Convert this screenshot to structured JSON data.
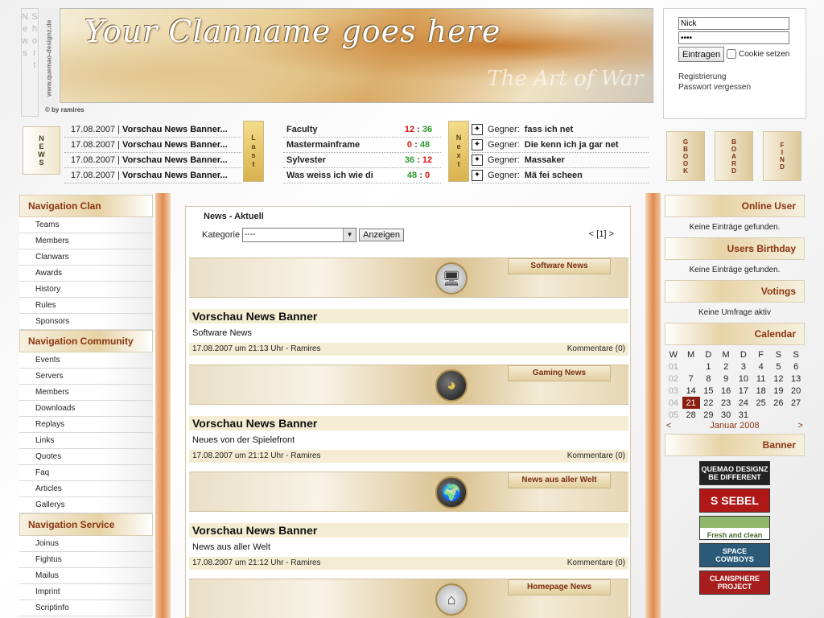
{
  "header": {
    "shortnews_label": "Short News",
    "domain": "www.quemao-designz.de",
    "byline": "© by ramires",
    "title": "Your Clanname goes here",
    "subtitle": "The Art of War"
  },
  "login": {
    "username": "Nick",
    "password": "****",
    "submit_label": "Eintragen",
    "cookie_label": "Cookie setzen",
    "register_link": "Registrierung",
    "forgot_link": "Passwort vergessen"
  },
  "ticker": {
    "news_tab": "NEWS",
    "shortnews": [
      {
        "date": "17.08.2007",
        "title": "Vorschau News Banner..."
      },
      {
        "date": "17.08.2007",
        "title": "Vorschau News Banner..."
      },
      {
        "date": "17.08.2007",
        "title": "Vorschau News Banner..."
      },
      {
        "date": "17.08.2007",
        "title": "Vorschau News Banner..."
      }
    ],
    "last_tab": "Last",
    "last_matches": [
      {
        "name": "Faculty",
        "score_a": "12",
        "score_b": "36",
        "a_color": "red",
        "b_color": "green"
      },
      {
        "name": "Mastermainframe",
        "score_a": "0",
        "score_b": "48",
        "a_color": "red",
        "b_color": "green"
      },
      {
        "name": "Sylvester",
        "score_a": "36",
        "score_b": "12",
        "a_color": "green",
        "b_color": "red"
      },
      {
        "name": "Was weiss ich wie di",
        "score_a": "48",
        "score_b": "0",
        "a_color": "green",
        "b_color": "red"
      }
    ],
    "next_tab": "Next",
    "next_matches": [
      {
        "label": "Gegner:",
        "name": "fass ich net"
      },
      {
        "label": "Gegner:",
        "name": "Die kenn ich ja gar net"
      },
      {
        "label": "Gegner:",
        "name": "Massaker"
      },
      {
        "label": "Gegner:",
        "name": "Mä fei scheen"
      }
    ],
    "quick_links": [
      "GBOOK",
      "BOARD",
      "FIND"
    ]
  },
  "left_nav": {
    "sections": [
      {
        "title": "Navigation Clan",
        "items": [
          "Teams",
          "Members",
          "Clanwars",
          "Awards",
          "History",
          "Rules",
          "Sponsors"
        ]
      },
      {
        "title": "Navigation Community",
        "items": [
          "Events",
          "Servers",
          "Members",
          "Downloads",
          "Replays",
          "Links",
          "Quotes",
          "Faq",
          "Articles",
          "Gallerys"
        ]
      },
      {
        "title": "Navigation Service",
        "items": [
          "Joinus",
          "Fightus",
          "Mailus",
          "Imprint",
          "Scriptinfo"
        ]
      }
    ]
  },
  "main": {
    "title": "News - Aktuell",
    "filter_label": "Kategorie",
    "filter_value": "----",
    "filter_button": "Anzeigen",
    "pager": "< [1] >",
    "articles": [
      {
        "category": "Software News",
        "headline": "Vorschau News Banner",
        "text": "Software News",
        "meta": "17.08.2007 um 21:13 Uhr - Ramires",
        "comments": "Kommentare (0)",
        "icon": "computer-icon"
      },
      {
        "category": "Gaming News",
        "headline": "Vorschau News Banner",
        "text": "Neues von der Spielefront",
        "meta": "17.08.2007 um 21:12 Uhr - Ramires",
        "comments": "Kommentare (0)",
        "icon": "pacman-icon"
      },
      {
        "category": "News aus aller Welt",
        "headline": "Vorschau News Banner",
        "text": "News aus aller Welt",
        "meta": "17.08.2007 um 21:12 Uhr - Ramires",
        "comments": "Kommentare (0)",
        "icon": "globe-icon"
      },
      {
        "category": "Homepage News",
        "icon": "house-icon"
      }
    ]
  },
  "right": {
    "online_title": "Online User",
    "online_text": "Keine Einträge gefunden.",
    "birthday_title": "Users Birthday",
    "birthday_text": "Keine Einträge gefunden.",
    "votings_title": "Votings",
    "votings_text": "Keine Umfrage aktiv",
    "calendar_title": "Calendar",
    "calendar": {
      "weekdays": [
        "W",
        "M",
        "D",
        "M",
        "D",
        "F",
        "S",
        "S"
      ],
      "weeks": [
        [
          "01",
          "",
          "1",
          "2",
          "3",
          "4",
          "5",
          "6"
        ],
        [
          "02",
          "7",
          "8",
          "9",
          "10",
          "11",
          "12",
          "13"
        ],
        [
          "03",
          "14",
          "15",
          "16",
          "17",
          "18",
          "19",
          "20"
        ],
        [
          "04",
          "21",
          "22",
          "23",
          "24",
          "25",
          "26",
          "27"
        ],
        [
          "05",
          "28",
          "29",
          "30",
          "31",
          "",
          "",
          ""
        ]
      ],
      "today": "21",
      "prev": "<",
      "month": "Januar 2008",
      "next": ">"
    },
    "banner_title": "Banner",
    "banners": [
      {
        "line1": "QUEMAO DESIGNZ",
        "line2": "BE DIFFERENT",
        "bg": "#222222"
      },
      {
        "line1": "S SEBEL",
        "line2": "",
        "bg": "#b01818"
      },
      {
        "line1": "",
        "line2": "Fresh and clean",
        "bg": "#8fb86a"
      },
      {
        "line1": "SPACE",
        "line2": "COWBOYS",
        "bg": "#2a5a78"
      },
      {
        "line1": "CLANSPHERE",
        "line2": "PROJECT",
        "bg": "#a81e1e"
      }
    ]
  }
}
